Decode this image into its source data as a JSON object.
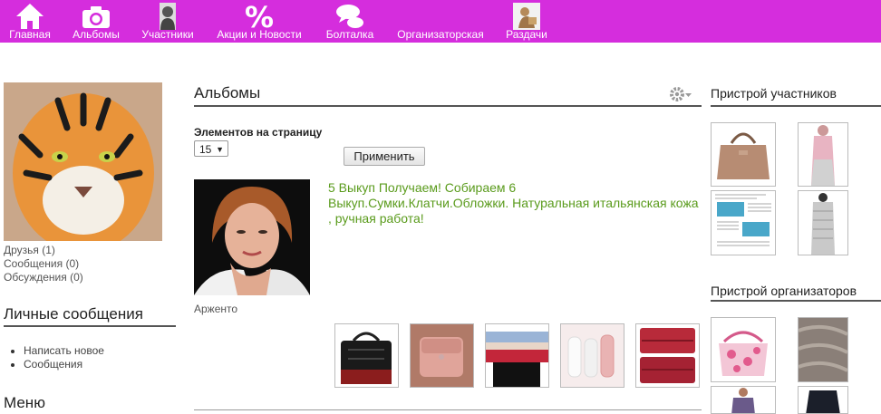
{
  "nav": {
    "home": "Главная",
    "albums": "Альбомы",
    "members": "Участники",
    "news": "Акции и Новости",
    "chat": "Болталка",
    "organizers": "Организаторская",
    "giveaways": "Раздачи"
  },
  "sidebar": {
    "friends": "Друзья (1)",
    "messages": "Сообщения (0)",
    "discussions": "Обсуждения (0)",
    "pm_title": "Личные сообщения",
    "pm_items": [
      "Написать новое",
      "Сообщения"
    ],
    "menu_title": "Меню"
  },
  "main": {
    "title": "Альбомы",
    "per_page_label": "Элементов на страницу",
    "per_page_value": "15",
    "apply": "Применить",
    "album_title": "5 Выкуп Получаем! Собираем 6 Выкуп.Сумки.Клатчи.Обложки. Натуральная итальянская кожа , ручная работа!",
    "author": "Арженто"
  },
  "right": {
    "members_title": "Пристрой участников",
    "org_title": "Пристрой организаторов"
  },
  "colors": {
    "nav_bg": "#d52ddd",
    "link_green": "#5a9b1c"
  },
  "icons": [
    "home-icon",
    "camera-icon",
    "person-icon",
    "percent-icon",
    "chat-bubbles-icon",
    "organizer-icon",
    "gift-icon",
    "gear-icon"
  ]
}
